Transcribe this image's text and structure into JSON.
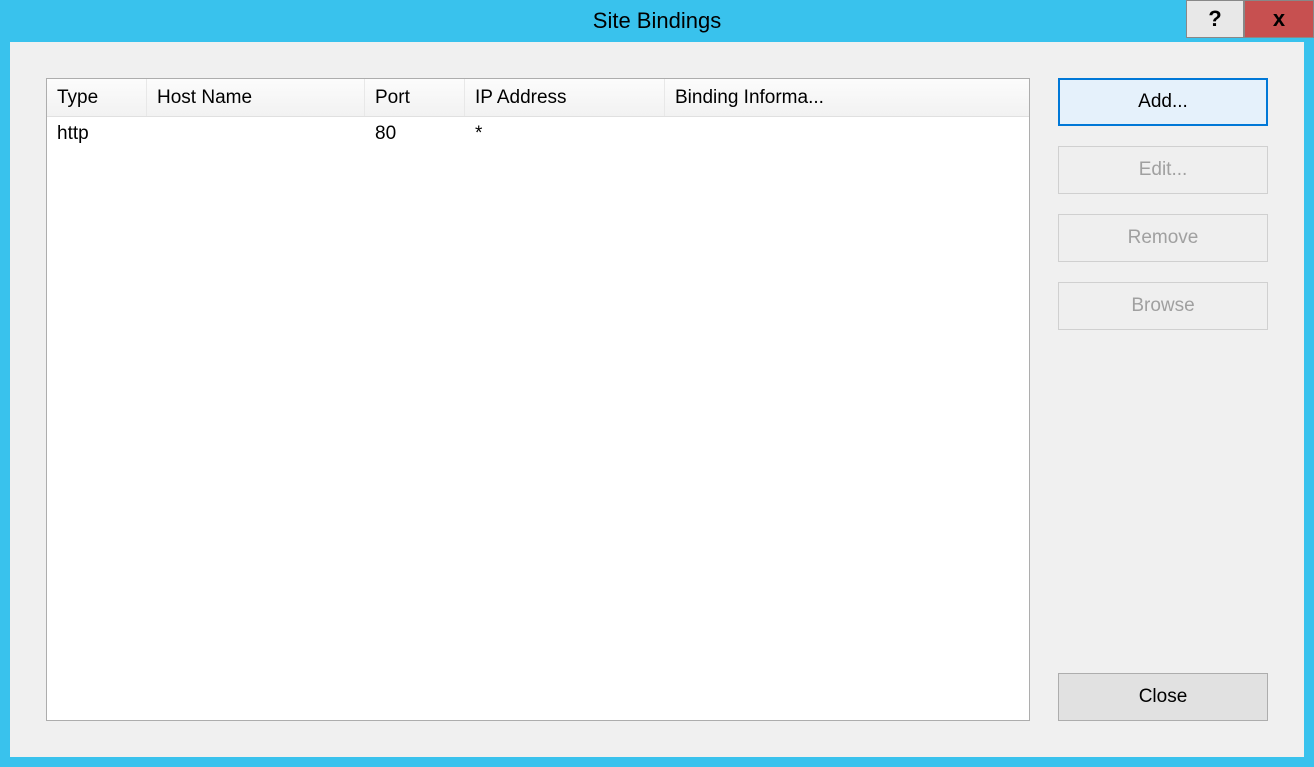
{
  "window": {
    "title": "Site Bindings",
    "help_symbol": "?",
    "close_symbol": "x"
  },
  "table": {
    "columns": {
      "type": "Type",
      "host": "Host Name",
      "port": "Port",
      "ip": "IP Address",
      "binding": "Binding Informa..."
    },
    "rows": [
      {
        "type": "http",
        "host": "",
        "port": "80",
        "ip": "*",
        "binding": ""
      }
    ]
  },
  "buttons": {
    "add": "Add...",
    "edit": "Edit...",
    "remove": "Remove",
    "browse": "Browse",
    "close": "Close"
  }
}
